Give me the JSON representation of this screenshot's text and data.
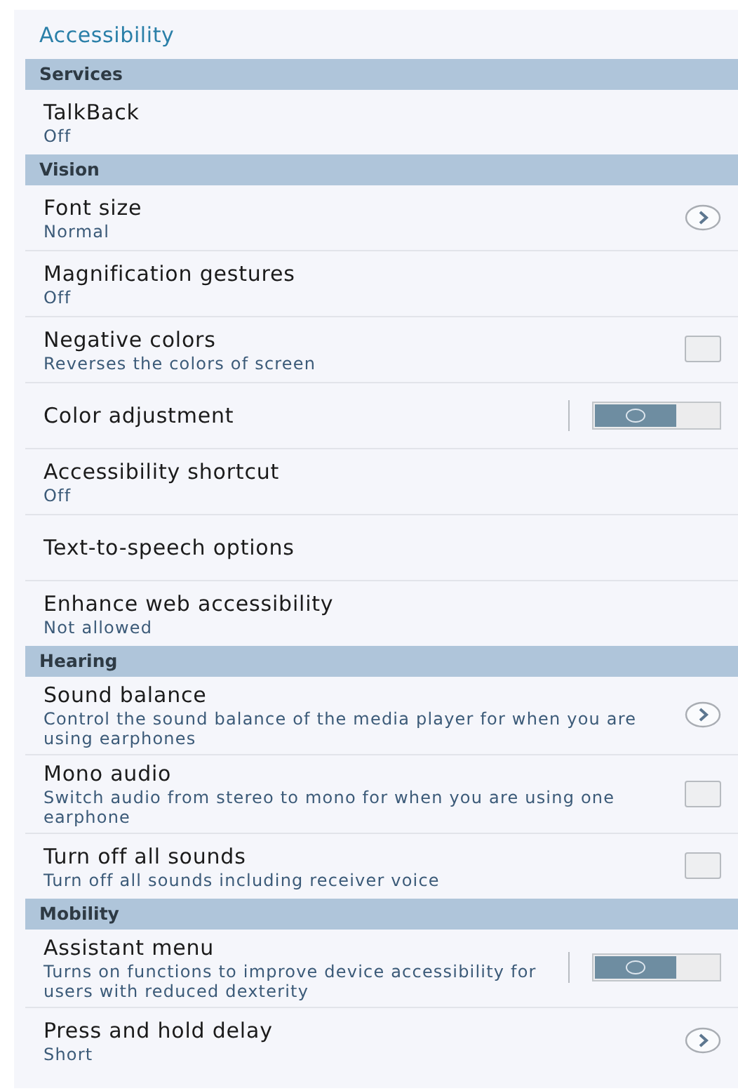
{
  "title": "Accessibility",
  "sections": [
    {
      "header": "Services",
      "items": [
        {
          "kind": "plain",
          "title": "TalkBack",
          "subtitle": "Off"
        }
      ]
    },
    {
      "header": "Vision",
      "items": [
        {
          "kind": "chevron",
          "title": "Font size",
          "subtitle": "Normal"
        },
        {
          "kind": "plain",
          "title": "Magnification gestures",
          "subtitle": "Off"
        },
        {
          "kind": "checkbox",
          "title": "Negative colors",
          "subtitle": "Reverses the colors of screen",
          "checked": false
        },
        {
          "kind": "switch",
          "title": "Color adjustment",
          "on": false
        },
        {
          "kind": "plain",
          "title": "Accessibility shortcut",
          "subtitle": "Off"
        },
        {
          "kind": "plain",
          "title": "Text-to-speech options"
        },
        {
          "kind": "plain",
          "title": "Enhance web accessibility",
          "subtitle": "Not allowed"
        }
      ]
    },
    {
      "header": "Hearing",
      "items": [
        {
          "kind": "chevron",
          "title": "Sound balance",
          "subtitle": "Control the sound balance of the media player for when you are using earphones"
        },
        {
          "kind": "checkbox",
          "title": "Mono audio",
          "subtitle": "Switch audio from stereo to mono for when you are using one earphone",
          "checked": false
        },
        {
          "kind": "checkbox",
          "title": "Turn off all sounds",
          "subtitle": "Turn off all sounds including receiver voice",
          "checked": false
        }
      ]
    },
    {
      "header": "Mobility",
      "items": [
        {
          "kind": "switch",
          "title": "Assistant menu",
          "subtitle": "Turns on functions to improve device accessibility for users with reduced dexterity",
          "on": false
        },
        {
          "kind": "chevron",
          "title": "Press and hold delay",
          "subtitle": "Short"
        }
      ]
    }
  ]
}
